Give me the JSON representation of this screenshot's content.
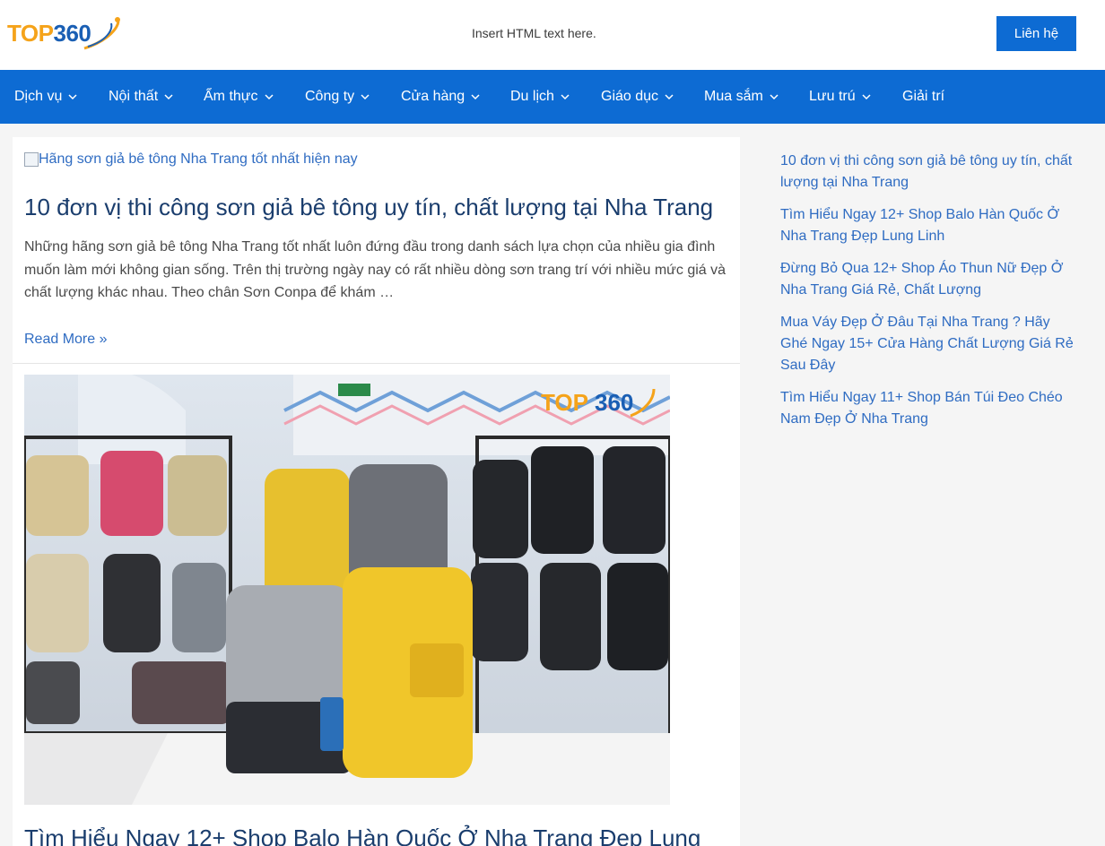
{
  "header": {
    "logo_text_a": "TOP",
    "logo_text_b": "360",
    "insert_text": "Insert HTML text here.",
    "contact_label": "Liên hệ",
    "brand_blue": "#0d6bd3",
    "brand_orange": "#f5a31a"
  },
  "nav": {
    "items": [
      {
        "label": "Dịch vụ",
        "has_dropdown": true
      },
      {
        "label": "Nội thất",
        "has_dropdown": true
      },
      {
        "label": "Ẩm thực",
        "has_dropdown": true
      },
      {
        "label": "Công ty",
        "has_dropdown": true
      },
      {
        "label": "Cửa hàng",
        "has_dropdown": true
      },
      {
        "label": "Du lịch",
        "has_dropdown": true
      },
      {
        "label": "Giáo dục",
        "has_dropdown": true
      },
      {
        "label": "Mua sắm",
        "has_dropdown": true
      },
      {
        "label": "Lưu trú",
        "has_dropdown": true
      },
      {
        "label": "Giải trí",
        "has_dropdown": false
      }
    ]
  },
  "posts": [
    {
      "image_alt": "Hãng sơn giả bê tông Nha Trang tốt nhất hiện nay",
      "title": "10 đơn vị thi công sơn giả bê tông uy tín, chất lượng tại Nha Trang",
      "excerpt": "Những hãng sơn giả bê tông Nha Trang tốt nhất luôn đứng đầu trong danh sách lựa chọn của nhiều gia đình muốn làm mới không gian sống. Trên thị trường ngày nay có rất nhiều dòng sơn trang trí với nhiều mức giá và chất lượng khác nhau. Theo chân Sơn Conpa để khám …",
      "read_more": "Read More »"
    },
    {
      "image_watermark_a": "TOP",
      "image_watermark_b": "360",
      "title": "Tìm Hiểu Ngay 12+ Shop Balo Hàn Quốc Ở Nha Trang Đẹp Lung"
    }
  ],
  "sidebar": {
    "links": [
      "10 đơn vị thi công sơn giả bê tông uy tín, chất lượng tại Nha Trang",
      "Tìm Hiểu Ngay 12+ Shop Balo Hàn Quốc Ở Nha Trang Đẹp Lung Linh",
      "Đừng Bỏ Qua 12+ Shop Áo Thun Nữ Đẹp Ở Nha Trang Giá Rẻ, Chất Lượng",
      "Mua Váy Đẹp Ở Đâu Tại Nha Trang ? Hãy Ghé Ngay 15+ Cửa Hàng Chất Lượng Giá Rẻ Sau Đây",
      "Tìm Hiểu Ngay 11+ Shop Bán Túi Đeo Chéo Nam Đẹp Ở Nha Trang"
    ]
  }
}
